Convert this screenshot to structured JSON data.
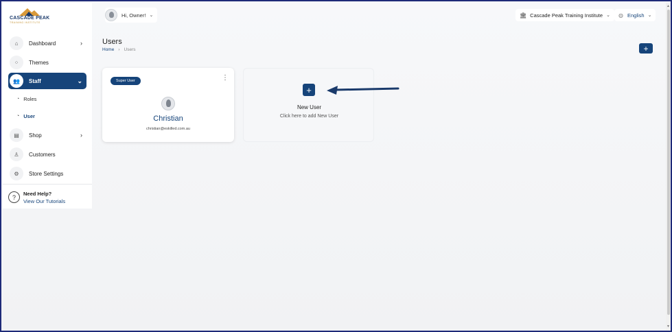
{
  "brand": {
    "name": "CASCADE PEAK",
    "tagline": "TRAINING INSTITUTE"
  },
  "header": {
    "greeting": "Hi, Owner!",
    "institute": "Cascade Peak Training Institute",
    "language": "English"
  },
  "sidebar": {
    "items": [
      {
        "label": "Dashboard",
        "icon": "home-icon",
        "chevron": "›"
      },
      {
        "label": "Themes",
        "icon": "themes-icon"
      },
      {
        "label": "Staff",
        "icon": "users-icon",
        "chevron": "⌄"
      },
      {
        "label": "Shop",
        "icon": "shop-icon",
        "chevron": "›"
      },
      {
        "label": "Customers",
        "icon": "person-icon"
      },
      {
        "label": "Store Settings",
        "icon": "settings-icon"
      }
    ],
    "sub_items": [
      {
        "label": "Roles"
      },
      {
        "label": "User"
      }
    ],
    "help": {
      "title": "Need Help?",
      "link": "View Our Tutorials"
    }
  },
  "page": {
    "title": "Users",
    "breadcrumb": {
      "home": "Home",
      "separator": "›",
      "current": "Users"
    },
    "add_button": "+"
  },
  "user_card": {
    "badge": "Super User",
    "menu": "⋮",
    "name": "Christian",
    "email": "christian@eskilled.com.au"
  },
  "new_user_card": {
    "plus": "+",
    "title": "New User",
    "subtitle": "Click here to add New User"
  },
  "colors": {
    "primary": "#16447a",
    "accent": "#c7973a",
    "frame": "#1e2a78"
  }
}
